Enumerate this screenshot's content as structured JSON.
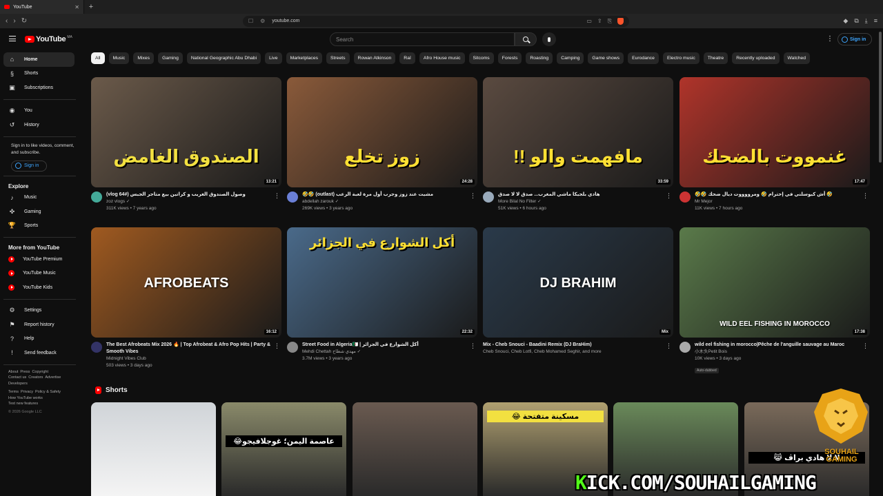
{
  "browser": {
    "tab_title": "YouTube",
    "url": "youtube.com",
    "new_tab_glyph": "+"
  },
  "header": {
    "logo_text": "YouTube",
    "logo_country": "MA",
    "search_placeholder": "Search",
    "sign_in": "Sign in"
  },
  "sidebar": {
    "main": [
      {
        "label": "Home",
        "icon": "home-icon",
        "glyph": "⌂",
        "active": true
      },
      {
        "label": "Shorts",
        "icon": "shorts-icon",
        "glyph": "§"
      },
      {
        "label": "Subscriptions",
        "icon": "subscriptions-icon",
        "glyph": "▣"
      }
    ],
    "you": [
      {
        "label": "You",
        "icon": "you-icon",
        "glyph": "◉"
      },
      {
        "label": "History",
        "icon": "history-icon",
        "glyph": "↺"
      }
    ],
    "signin_note": "Sign in to like videos, comment, and subscribe.",
    "signin_button": "Sign in",
    "explore_heading": "Explore",
    "explore": [
      {
        "label": "Music",
        "icon": "music-icon",
        "glyph": "♪"
      },
      {
        "label": "Gaming",
        "icon": "gaming-icon",
        "glyph": "✜"
      },
      {
        "label": "Sports",
        "icon": "sports-icon",
        "glyph": "🏆"
      }
    ],
    "more_heading": "More from YouTube",
    "more": [
      {
        "label": "YouTube Premium",
        "icon": "youtube-premium-icon"
      },
      {
        "label": "YouTube Music",
        "icon": "youtube-music-icon"
      },
      {
        "label": "YouTube Kids",
        "icon": "youtube-kids-icon"
      }
    ],
    "settings": [
      {
        "label": "Settings",
        "icon": "gear-icon",
        "glyph": "⚙"
      },
      {
        "label": "Report history",
        "icon": "flag-icon",
        "glyph": "⚑"
      },
      {
        "label": "Help",
        "icon": "help-icon",
        "glyph": "?"
      },
      {
        "label": "Send feedback",
        "icon": "feedback-icon",
        "glyph": "!"
      }
    ],
    "footer_line1": [
      "About",
      "Press",
      "Copyright"
    ],
    "footer_line2": [
      "Contact us",
      "Creators",
      "Advertise"
    ],
    "footer_line3": [
      "Developers"
    ],
    "footer_line4": [
      "Terms",
      "Privacy",
      "Policy & Safety"
    ],
    "footer_line5": [
      "How YouTube works"
    ],
    "footer_line6": [
      "Test new features"
    ],
    "copyright": "© 2026 Google LLC"
  },
  "chips": [
    "All",
    "Music",
    "Mixes",
    "Gaming",
    "National Geographic Abu Dhabi",
    "Live",
    "Marketplaces",
    "Streets",
    "Rowan Atkinson",
    "Raï",
    "Afro House music",
    "Sitcoms",
    "Forests",
    "Roasting",
    "Camping",
    "Game shows",
    "Eurodance",
    "Electro music",
    "Theatre",
    "Recently uploaded",
    "Watched"
  ],
  "videos": [
    {
      "title": "(vlog 64#) وصول الصندوق الغريب و كراتين بيع متاجر الجبس",
      "channel": "zoz vlogs",
      "stats": "311K views • 7 years ago",
      "duration": "13:21",
      "thumb_text": "الصندوق الغامض",
      "thumb_color": "#6b5a4a",
      "avatar_color": "#4a9",
      "verified": true
    },
    {
      "title": "🤣🤣 (outlast) مشيت عند زوز وجرب أول مرة لعبة الرعب",
      "channel": "abdellah zarouk",
      "stats": "269K views • 3 years ago",
      "duration": "24:28",
      "thumb_text": "زوز تخلع",
      "thumb_color": "#8a5a3a",
      "avatar_color": "#6a7fd6",
      "verified": true
    },
    {
      "title": "هادي بلجيكا ماشي المغرب... صدق لا لا صدق",
      "channel": "More Bilal No Filter",
      "stats": "51K views • 6 hours ago",
      "duration": "33:59",
      "thumb_text": "مافهمت والو !!",
      "thumb_color": "#5a4a40",
      "avatar_color": "#9ab",
      "verified": true
    },
    {
      "title": "🤣🤣 أش كيوسلني في إحترام 🤣 ومرووووت ديال ضحك 🤣",
      "channel": "Mr Mejor",
      "stats": "11K views • 7 hours ago",
      "duration": "17:47",
      "thumb_text": "غنمووت بالضحك",
      "thumb_color": "#b0342a",
      "avatar_color": "#c33",
      "verified": false
    },
    {
      "title": "The Best Afrobeats Mix 2026 🔥 | Top Afrobeat & Afro Pop Hits | Party & Smooth Vibes",
      "channel": "Midnight Vibes Club",
      "stats": "503 views • 3 days ago",
      "duration": "16:12",
      "thumb_text": "AFROBEATS",
      "thumb_color": "#a05a20",
      "avatar_color": "#336",
      "verified": false
    },
    {
      "title": "Street Food in Algeria🇩🇿 | أكل الشوارع في الجزائر",
      "channel": "Mehdi Chettah مهدي شطاح",
      "stats": "3.7M views • 3 years ago",
      "duration": "22:32",
      "thumb_text": "أكل الشوارع في الجزائر",
      "thumb_color": "#4a6a8a",
      "avatar_color": "#888",
      "verified": true
    },
    {
      "title": "Mix - Cheb Snouci - Baadini Remix (DJ BraHim)",
      "channel": "Cheb Snouci, Cheb Lotfi, Cheb Mohamed Seghir, and more",
      "stats": "",
      "duration": "Mix",
      "thumb_text": "DJ BRAHIM",
      "thumb_color": "#2a3a4a",
      "avatar_color": "",
      "verified": false
    },
    {
      "title": "wild eel fishing in morocco|Pêche de l'anguille sauvage au Maroc",
      "channel": "小木头Petit Bois",
      "stats": "10K views • 3 days ago",
      "duration": "17:38",
      "thumb_text": "WILD EEL FISHING IN MOROCCO",
      "thumb_color": "#5a7a4a",
      "avatar_color": "#aaa",
      "verified": false,
      "badge": "Auto-dubbed"
    }
  ],
  "shorts_heading": "Shorts",
  "shorts": [
    {
      "caption": "",
      "color": "#9aa0a6"
    },
    {
      "caption": "عاصمة اليمن؛ غوجلافيجو😂",
      "color": "#8a8a6a"
    },
    {
      "caption": "",
      "color": "#6a5a50"
    },
    {
      "caption": "مسكينة متفتحة 😂",
      "color": "#b0a070"
    },
    {
      "caption": "",
      "color": "#6a8a5a"
    },
    {
      "caption": "لا لا هادي براڤ 😹",
      "color": "#7a6a5a"
    }
  ],
  "overlay": {
    "kick_prefix": "K",
    "kick_rest": "ICK.COM/SOUHAILGAMING",
    "brand": "SOUHAIL GAMING"
  },
  "colors": {
    "background": "#0f0f0f",
    "accent": "#ff0000",
    "link": "#3ea6ff",
    "kick_green": "#53fc18"
  }
}
